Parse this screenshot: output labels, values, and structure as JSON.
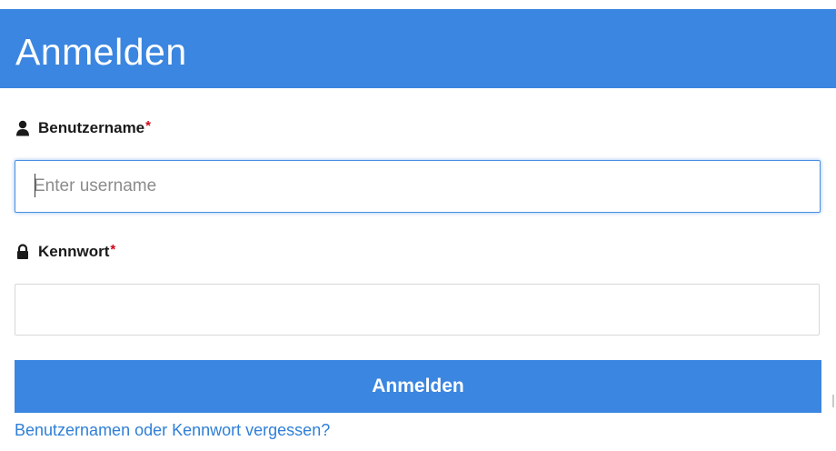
{
  "header": {
    "title": "Anmelden"
  },
  "username": {
    "label": "Benutzername",
    "required_mark": "*",
    "icon": "user-icon",
    "placeholder": "Enter username",
    "value": ""
  },
  "password": {
    "label": "Kennwort",
    "required_mark": "*",
    "icon": "lock-icon",
    "placeholder": "",
    "value": ""
  },
  "submit": {
    "label": "Anmelden"
  },
  "forgot": {
    "label": "Benutzernamen oder Kennwort vergessen?"
  },
  "colors": {
    "accent": "#3b86e0",
    "required": "#d0021b",
    "link": "#2f7fd6",
    "focus_border": "#4a90e2"
  }
}
